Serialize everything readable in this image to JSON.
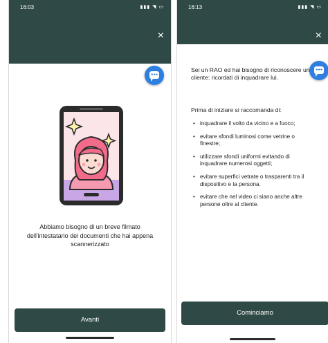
{
  "left_screen": {
    "status": {
      "time": "16:03",
      "indicators": "▮▮▮ ◥ ▭"
    },
    "close_icon": "×",
    "chat_icon": "chat-bubble-icon",
    "body_text": "Abbiamo bisogno di un breve filmato dell'intestatario dei documenti che hai appena scannerizzato",
    "button_label": "Avanti"
  },
  "right_screen": {
    "status": {
      "time": "16:13",
      "indicators": "▮▮▮ ◥ ▭"
    },
    "close_icon": "×",
    "chat_icon": "chat-bubble-icon",
    "intro": "Sei un RAO ed hai bisogno di riconoscere un cliente: ricordati di inquadrare lui.",
    "section_title": "Prima di iniziare si raccomanda di:",
    "bullet": "•",
    "recommendations": [
      "inquadrare il volto da vicino e a fuoco;",
      "evitare sfondi luminosi come vetrine o finestre;",
      "utilizzare sfondi uniformi evitando di inquadrare numerosi oggetti;",
      "evitare superfici vetrate o trasparenti tra il dispositivo e la persona.",
      "evitare che nel video ci siano anche altre persone oltre al cliente."
    ],
    "button_label": "Cominciamo"
  },
  "colors": {
    "header": "#2f4a46",
    "button": "#2f4a46",
    "chat_fab": "#2e7fe0",
    "phone_screen": "#fbe5e8",
    "phone_bezel_bottom": "#c9a6e6",
    "hair": "#f26b8b",
    "skin": "#fcdcd2"
  }
}
